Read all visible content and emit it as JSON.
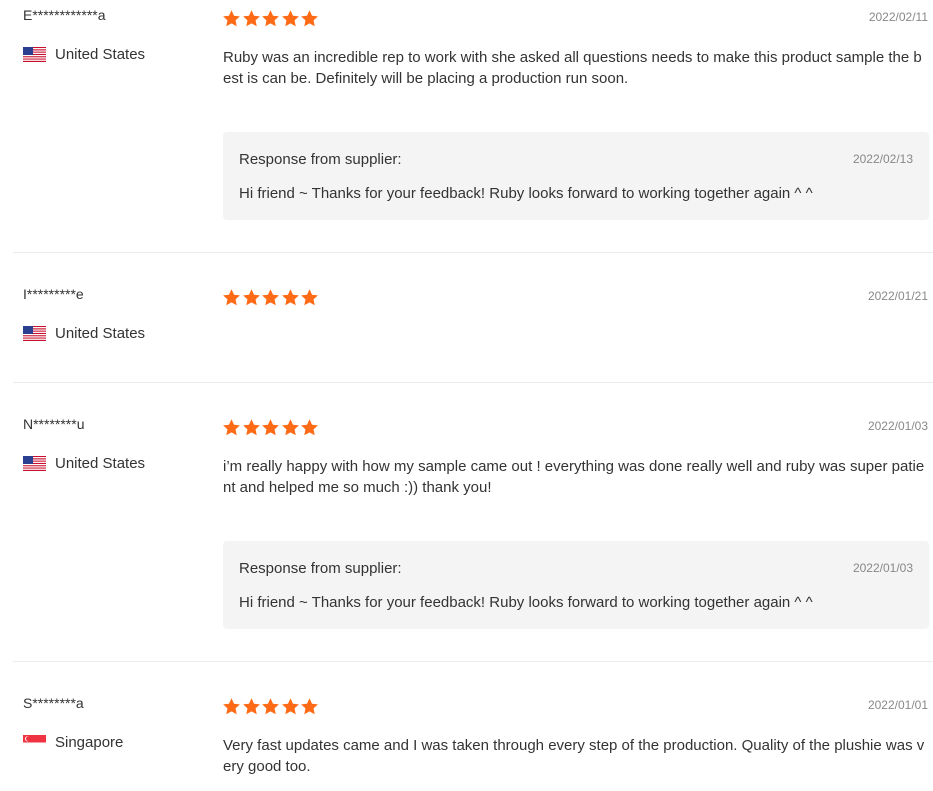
{
  "rating_color": "#ff6a16",
  "reviews": [
    {
      "name": "E************a",
      "country": "United States",
      "flag": "us-flag-icon",
      "rating": 5,
      "date": "2022/02/11",
      "text": "Ruby was an incredible rep to work with she asked all questions needs to make this product sample the best is can be. Definitely will be placing a production run soon.",
      "response": {
        "label": "Response from supplier:",
        "date": "2022/02/13",
        "text": "Hi friend ~ Thanks for your feedback! Ruby looks forward to working together again ^ ^"
      }
    },
    {
      "name": "I*********e",
      "country": "United States",
      "flag": "us-flag-icon",
      "rating": 5,
      "date": "2022/01/21",
      "text": ""
    },
    {
      "name": "N********u",
      "country": "United States",
      "flag": "us-flag-icon",
      "rating": 5,
      "date": "2022/01/03",
      "text": "i’m really happy with how my sample came out ! everything was done really well and ruby was super patient and helped me so much :)) thank you!",
      "response": {
        "label": "Response from supplier:",
        "date": "2022/01/03",
        "text": "Hi friend ~ Thanks for your feedback! Ruby looks forward to working together again ^ ^"
      }
    },
    {
      "name": "S********a",
      "country": "Singapore",
      "flag": "sg-flag-icon",
      "rating": 5,
      "date": "2022/01/01",
      "text": "Very fast updates came and I was taken through every step of the production. Quality of the plushie was very good too."
    }
  ]
}
